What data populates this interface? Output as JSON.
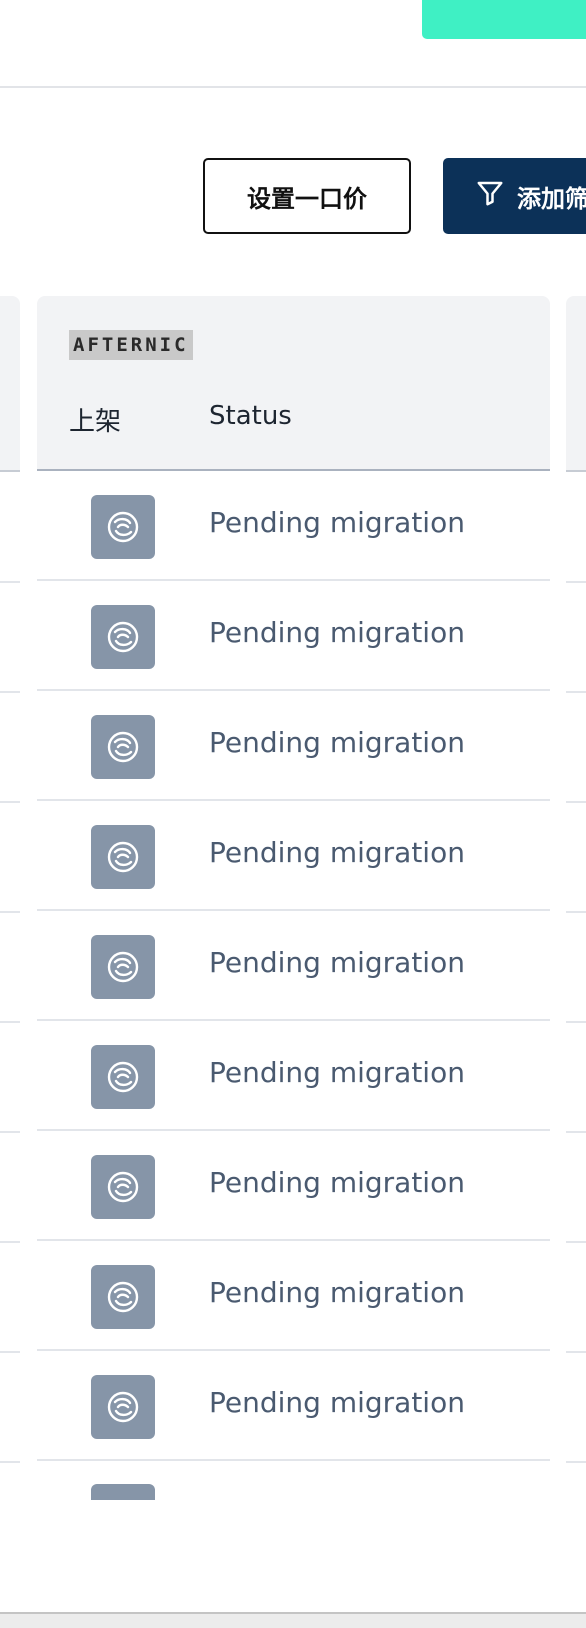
{
  "toolbar": {
    "fixed_price_label": "设置一口价",
    "filter_label": "添加筛选",
    "filter_icon": "filter-icon"
  },
  "table": {
    "provider_label": "AFTERNIC",
    "columns": {
      "list": "上架",
      "status": "Status"
    },
    "rows": [
      {
        "icon": "afternic-logo-icon",
        "status": "Pending migration"
      },
      {
        "icon": "afternic-logo-icon",
        "status": "Pending migration"
      },
      {
        "icon": "afternic-logo-icon",
        "status": "Pending migration"
      },
      {
        "icon": "afternic-logo-icon",
        "status": "Pending migration"
      },
      {
        "icon": "afternic-logo-icon",
        "status": "Pending migration"
      },
      {
        "icon": "afternic-logo-icon",
        "status": "Pending migration"
      },
      {
        "icon": "afternic-logo-icon",
        "status": "Pending migration"
      },
      {
        "icon": "afternic-logo-icon",
        "status": "Pending migration"
      },
      {
        "icon": "afternic-logo-icon",
        "status": "Pending migration"
      }
    ]
  },
  "colors": {
    "primary_button": "#0c3158",
    "accent_button": "#3ff0c4",
    "status_text": "#4a5a70",
    "icon_tile": "#8695a8"
  }
}
